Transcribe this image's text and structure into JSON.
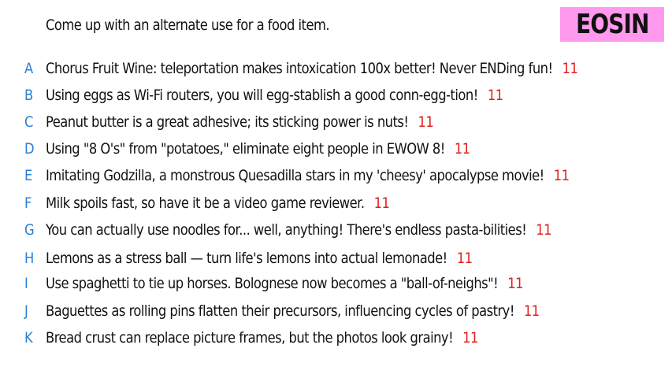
{
  "prompt": "Come up with an alternate use for a food item.",
  "badge": {
    "label": "EOSIN",
    "color": "#ff99ee"
  },
  "colors": {
    "letter": "#2a7fd4",
    "score": "#e0201c",
    "text": "#111111"
  },
  "entries": [
    {
      "letter": "A",
      "text": "Chorus Fruit Wine: teleportation makes intoxication 100x better! Never ENDing fun!",
      "score": "11"
    },
    {
      "letter": "B",
      "text": "Using eggs as Wi-Fi routers, you will egg-stablish a good conn-egg-tion!",
      "score": "11"
    },
    {
      "letter": "C",
      "text": "Peanut butter is a great adhesive; its sticking power is nuts!",
      "score": "11"
    },
    {
      "letter": "D",
      "text": "Using \"8 O's\" from \"potatoes,\" eliminate eight people in EWOW 8!",
      "score": "11"
    },
    {
      "letter": "E",
      "text": "Imitating Godzilla, a monstrous Quesadilla stars in my 'cheesy' apocalypse movie!",
      "score": "11"
    },
    {
      "letter": "F",
      "text": "Milk spoils fast, so have it be a video game reviewer.",
      "score": "11"
    },
    {
      "letter": "G",
      "text": "You can actually use noodles for... well, anything! There's endless pasta-bilities!",
      "score": "11"
    },
    {
      "letter": "H",
      "text": "Lemons as a stress ball — turn life's lemons into actual lemonade!",
      "score": "11"
    },
    {
      "letter": "I",
      "text": "Use spaghetti to tie up horses. Bolognese now becomes a \"ball-of-neighs\"!",
      "score": "11"
    },
    {
      "letter": "J",
      "text": "Baguettes as rolling pins flatten their precursors, influencing cycles of pastry!",
      "score": "11"
    },
    {
      "letter": "K",
      "text": "Bread crust can replace picture frames, but the photos look grainy!",
      "score": "11"
    }
  ]
}
